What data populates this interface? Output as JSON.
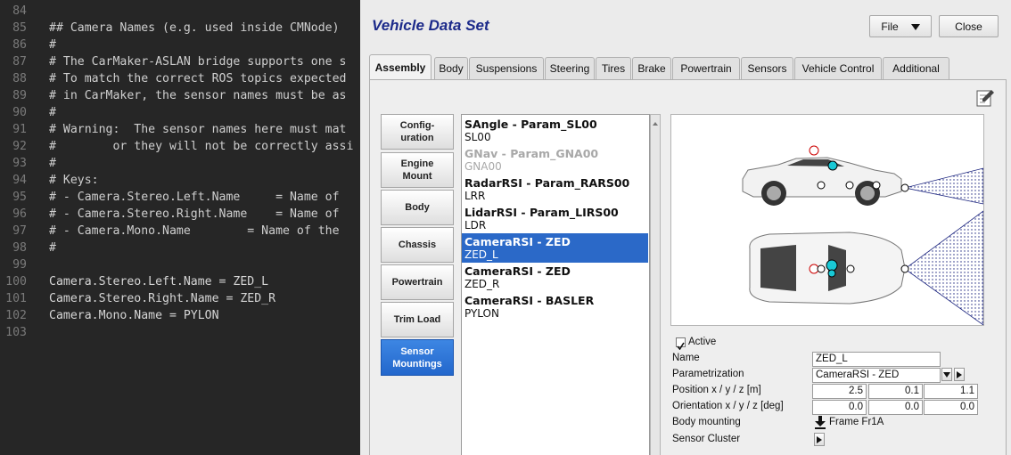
{
  "editor": {
    "lines": [
      {
        "num": "84",
        "text": ""
      },
      {
        "num": "85",
        "text": "## Camera Names (e.g. used inside CMNode)"
      },
      {
        "num": "86",
        "text": "#"
      },
      {
        "num": "87",
        "text": "# The CarMaker-ASLAN bridge supports one s"
      },
      {
        "num": "88",
        "text": "# To match the correct ROS topics expected"
      },
      {
        "num": "89",
        "text": "# in CarMaker, the sensor names must be as"
      },
      {
        "num": "90",
        "text": "#"
      },
      {
        "num": "91",
        "text": "# Warning:  The sensor names here must mat"
      },
      {
        "num": "92",
        "text": "#        or they will not be correctly assi"
      },
      {
        "num": "93",
        "text": "#"
      },
      {
        "num": "94",
        "text": "# Keys:"
      },
      {
        "num": "95",
        "text": "# - Camera.Stereo.Left.Name     = Name of"
      },
      {
        "num": "96",
        "text": "# - Camera.Stereo.Right.Name    = Name of"
      },
      {
        "num": "97",
        "text": "# - Camera.Mono.Name        = Name of the"
      },
      {
        "num": "98",
        "text": "#"
      },
      {
        "num": "99",
        "text": ""
      },
      {
        "num": "100",
        "text": "Camera.Stereo.Left.Name = ZED_L"
      },
      {
        "num": "101",
        "text": "Camera.Stereo.Right.Name = ZED_R"
      },
      {
        "num": "102",
        "text": "Camera.Mono.Name = PYLON"
      },
      {
        "num": "103",
        "text": ""
      }
    ]
  },
  "dialog": {
    "title": "Vehicle Data Set",
    "file_label": "File",
    "close_label": "Close",
    "tabs": [
      "Assembly",
      "Body",
      "Suspensions",
      "Steering",
      "Tires",
      "Brake",
      "Powertrain",
      "Sensors",
      "Vehicle Control",
      "Additional"
    ],
    "side_buttons": [
      "Config-\nuration",
      "Engine\nMount",
      "Body",
      "Chassis",
      "Powertrain",
      "Trim Load",
      "Sensor\nMountings"
    ],
    "sensors": [
      {
        "title": "SAngle - Param_SL00",
        "sub": "SL00"
      },
      {
        "title": "GNav - Param_GNA00",
        "sub": "GNA00"
      },
      {
        "title": "RadarRSI - Param_RARS00",
        "sub": "LRR"
      },
      {
        "title": "LidarRSI - Param_LIRS00",
        "sub": "LDR"
      },
      {
        "title": "CameraRSI - ZED",
        "sub": "ZED_L"
      },
      {
        "title": "CameraRSI - ZED",
        "sub": "ZED_R"
      },
      {
        "title": "CameraRSI - BASLER",
        "sub": "PYLON"
      }
    ],
    "props": {
      "active_label": "Active",
      "name_label": "Name",
      "name_value": "ZED_L",
      "param_label": "Parametrization",
      "param_value": "CameraRSI - ZED",
      "pos_label": "Position x / y / z [m]",
      "pos": [
        "2.5",
        "0.1",
        "1.1"
      ],
      "orient_label": "Orientation x / y / z [deg]",
      "orient": [
        "0.0",
        "0.0",
        "0.0"
      ],
      "mount_label": "Body mounting",
      "mount_value": "Frame Fr1A",
      "cluster_label": "Sensor Cluster"
    },
    "colors": {
      "title": "#1c2a8a",
      "selection": "#2b69c8",
      "camera_marker": "#19c9d6",
      "fov_lines": "#1a237e"
    }
  }
}
